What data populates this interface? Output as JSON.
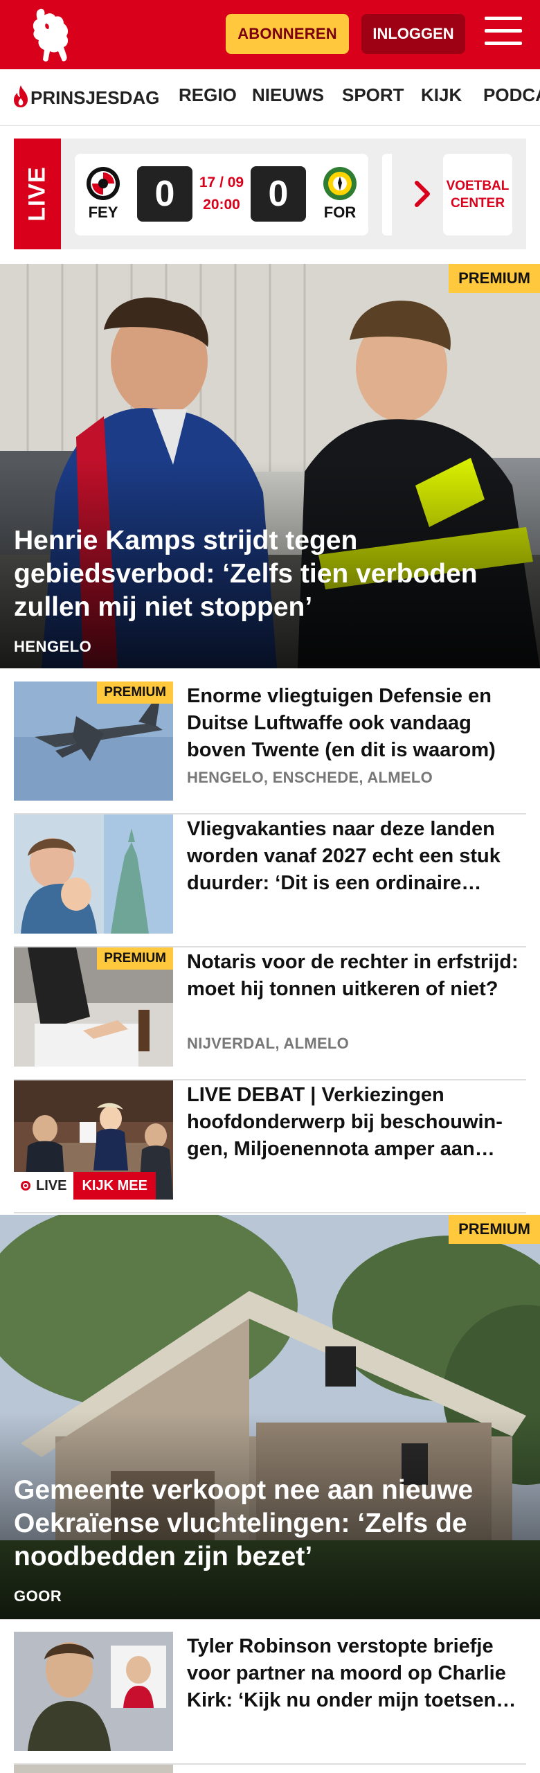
{
  "header": {
    "subscribe_label": "ABONNEREN",
    "login_label": "INLOGGEN",
    "brand_color": "#d9001b"
  },
  "nav": {
    "items": [
      {
        "label": "PRINSJESDAG",
        "icon": "flame-icon"
      },
      {
        "label": "REGIO"
      },
      {
        "label": "NIEUWS"
      },
      {
        "label": "SPORT"
      },
      {
        "label": "KIJK"
      },
      {
        "label": "PODCA"
      }
    ]
  },
  "live_widget": {
    "live_label": "LIVE",
    "home_team": "FEY",
    "away_team": "FOR",
    "home_score": "0",
    "away_score": "0",
    "date": "17 / 09",
    "time": "20:00",
    "center_label_1": "VOETBAL",
    "center_label_2": "CENTER"
  },
  "articles": [
    {
      "type": "hero",
      "premium": "PREMIUM",
      "title": "Henrie Kamps strijdt tegen gebiedsverbod: ‘Zelfs tien verboden zullen mij niet stoppen’",
      "location": "HENGELO"
    },
    {
      "type": "row",
      "premium": "PREMIUM",
      "title": "Enorme vliegtuigen Defensie en Duitse Luftwaffe ook vandaag boven Twente (en dit is waarom)",
      "location": "HENGELO, ENSCHEDE, ALMELO"
    },
    {
      "type": "row",
      "title": "Vliegvakanties naar deze landen worden vanaf 2027 echt een stuk duurder: ‘Dit is een ordinaire…"
    },
    {
      "type": "row",
      "premium": "PREMIUM",
      "title": "Notaris voor de rechter in erfstrijd: moet hij tonnen uitkeren of niet?",
      "location": "NIJVERDAL, ALMELO"
    },
    {
      "type": "row",
      "title": "LIVE DEBAT | Verkiezingen hoofdonderwerp bij beschouwin­gen, Miljoenennota amper aan…",
      "live_label": "LIVE",
      "watch_label": "KIJK MEE"
    },
    {
      "type": "hero",
      "premium": "PREMIUM",
      "title": "Gemeente verkoopt nee aan nieuwe Oekraïense vluchtelingen: ‘Zelfs de noodbedden zijn bezet’",
      "location": "GOOR"
    },
    {
      "type": "row",
      "title": "Tyler Robinson verstopte briefje voor partner na moord op Charlie Kirk: ‘Kijk nu onder mijn toetsen…"
    }
  ]
}
